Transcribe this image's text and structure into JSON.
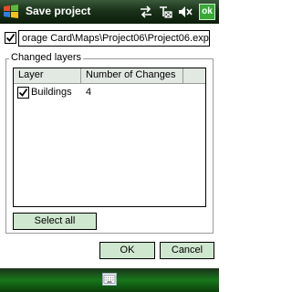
{
  "window": {
    "title": "Save project",
    "ok_label": "ok"
  },
  "file_path": "orage Card\\Maps\\Project06\\Project06.exp",
  "file_checked": true,
  "group": {
    "title": "Changed layers",
    "columns": [
      "Layer",
      "Number of Changes"
    ],
    "rows": [
      {
        "layer": "Buildings",
        "changes": "4",
        "checked": true
      }
    ]
  },
  "buttons": {
    "select_all": "Select all",
    "ok": "OK",
    "cancel": "Cancel"
  },
  "icons": [
    "windows-start-icon",
    "sync-arrows-icon",
    "no-signal-icon",
    "volume-mute-icon",
    "keyboard-icon"
  ]
}
